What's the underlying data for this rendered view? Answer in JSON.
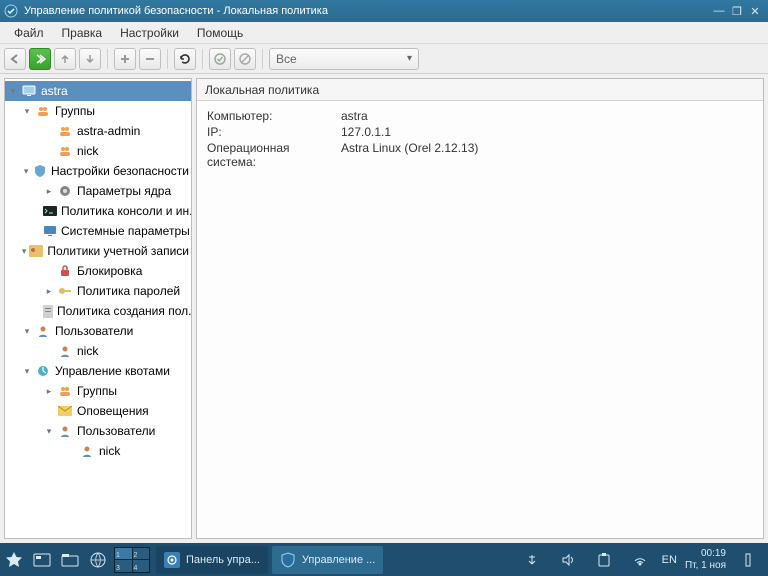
{
  "window": {
    "title": "Управление политикой безопасности - Локальная политика"
  },
  "menu": {
    "file": "Файл",
    "edit": "Правка",
    "settings": "Настройки",
    "help": "Помощь"
  },
  "filter": {
    "label": "Все"
  },
  "tree": {
    "root": "astra",
    "groups": {
      "label": "Группы",
      "items": [
        "astra-admin",
        "nick"
      ]
    },
    "sec": {
      "label": "Настройки безопасности",
      "kernel": "Параметры ядра",
      "console": "Политика консоли и ин...",
      "sys": "Системные параметры"
    },
    "acct": {
      "label": "Политики учетной записи",
      "lock": "Блокировка",
      "pwd": "Политика паролей",
      "create": "Политика создания пол..."
    },
    "users": {
      "label": "Пользователи",
      "items": [
        "nick"
      ]
    },
    "quota": {
      "label": "Управление квотами",
      "groups": "Группы",
      "notify": "Оповещения",
      "users": "Пользователи",
      "user_items": [
        "nick"
      ]
    }
  },
  "content": {
    "header": "Локальная политика",
    "computer_k": "Компьютер:",
    "computer_v": "astra",
    "ip_k": "IP:",
    "ip_v": "127.0.1.1",
    "os_k": "Операционная система:",
    "os_v": "Astra Linux (Orel 2.12.13)"
  },
  "taskbar": {
    "app1": "Панель упра...",
    "app2": "Управление ...",
    "lang": "EN",
    "time": "00:19",
    "date": "Пт, 1 ноя",
    "ws": [
      "1",
      "2",
      "3",
      "4"
    ]
  }
}
